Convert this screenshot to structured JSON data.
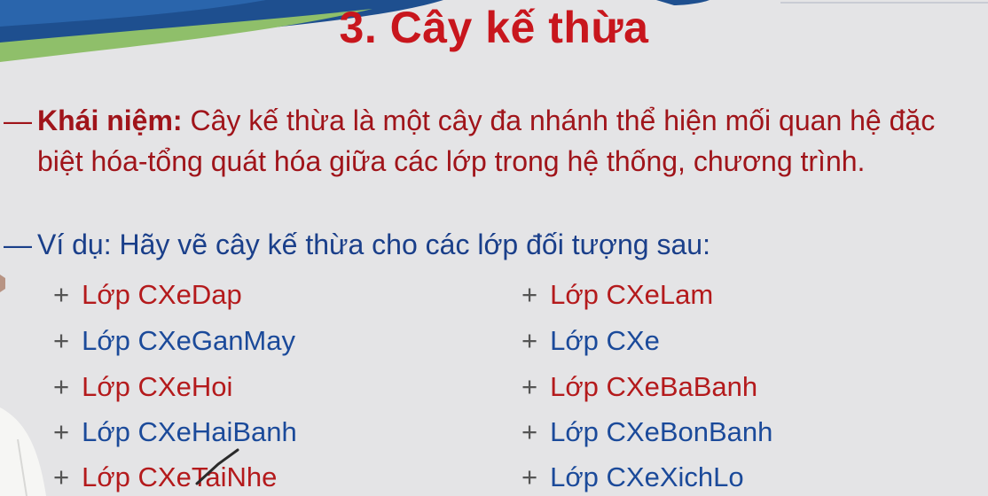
{
  "slide": {
    "title": "3. Cây kế thừa",
    "concept_dash": "—",
    "concept_label": "Khái niệm:",
    "concept_text": " Cây kế thừa là một cây đa nhánh thể hiện mối quan hệ đặc biệt hóa-tổng quát hóa giữa các lớp trong hệ thống, chương trình.",
    "example_dash": "—",
    "example_text": "Ví dụ: Hãy vẽ cây kế thừa cho các lớp đối tượng sau:",
    "plus_symbol": "+",
    "left_items": [
      "Lớp CXeDap",
      "Lớp CXeGanMay",
      "Lớp CXeHoi",
      "Lớp CXeHaiBanh",
      "Lớp CXeTaiNhe"
    ],
    "right_items": [
      "Lớp CXeLam",
      "Lớp CXe",
      "Lớp CXeBaBanh",
      "Lớp CXeBonBanh",
      "Lớp CXeXichLo"
    ]
  },
  "colors": {
    "title": "#c8161d",
    "red_text": "#b41a1c",
    "blue_text": "#1b4a9a",
    "background": "#e4e4e6"
  }
}
